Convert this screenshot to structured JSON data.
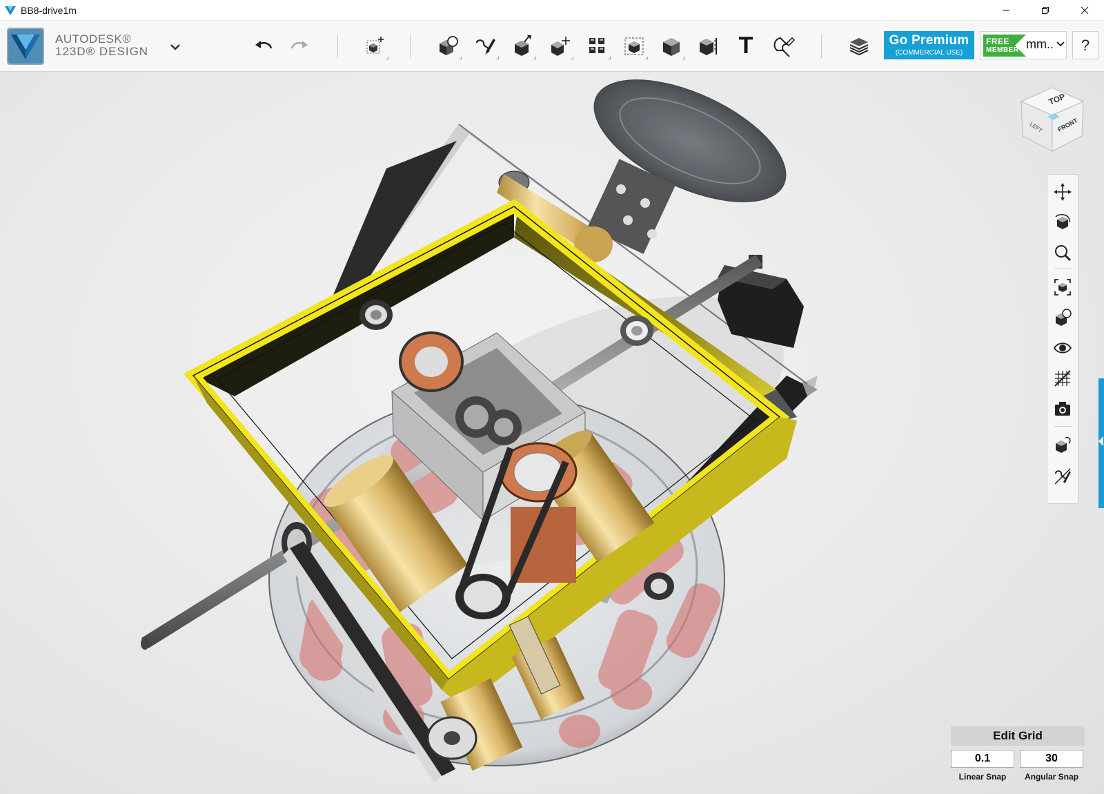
{
  "window": {
    "title": "BB8-drive1m"
  },
  "app": {
    "brand_line1": "AUTODESK®",
    "brand_line2": "123D® DESIGN"
  },
  "toolbar": {
    "tools": [
      {
        "name": "undo",
        "icon": "undo-arrow-icon"
      },
      {
        "name": "redo",
        "icon": "redo-arrow-icon"
      },
      {
        "name": "transform",
        "icon": "transform-box-icon"
      },
      {
        "name": "primitives",
        "icon": "primitives-icon"
      },
      {
        "name": "sketch",
        "icon": "sketch-icon"
      },
      {
        "name": "construct",
        "icon": "construct-icon"
      },
      {
        "name": "modify",
        "icon": "modify-icon"
      },
      {
        "name": "pattern",
        "icon": "pattern-icon"
      },
      {
        "name": "group",
        "icon": "group-icon"
      },
      {
        "name": "combine",
        "icon": "combine-icon"
      },
      {
        "name": "measure",
        "icon": "measure-icon"
      },
      {
        "name": "text",
        "icon": "text-icon"
      },
      {
        "name": "snap",
        "icon": "snap-magnet-icon"
      },
      {
        "name": "materials",
        "icon": "materials-layers-icon"
      }
    ],
    "text_glyph": "T",
    "premium_main": "Go Premium",
    "premium_sub": "(COMMERCIAL USE)",
    "member_line1": "FREE",
    "member_line2": "MEMBER",
    "units": "mm..",
    "help": "?"
  },
  "viewcube": {
    "top": "TOP",
    "front": "FRONT",
    "left": "LEFT"
  },
  "navbar": {
    "items": [
      "pan-icon",
      "orbit-icon",
      "zoom-icon",
      "fit-icon",
      "views-icon",
      "visibility-icon",
      "grid-icon",
      "camera-icon",
      "material-icon",
      "sketch-visibility-icon"
    ]
  },
  "edit_grid": {
    "title": "Edit Grid",
    "linear_snap_value": "0.1",
    "angular_snap_value": "30",
    "linear_snap_label": "Linear Snap",
    "angular_snap_label": "Angular Snap"
  },
  "colors": {
    "accent_blue": "#17a0d6",
    "member_green": "#3fae3f",
    "frame_yellow": "#f2e51c",
    "brass": "#e3c06a",
    "belt_dark": "#2a2a2a"
  }
}
